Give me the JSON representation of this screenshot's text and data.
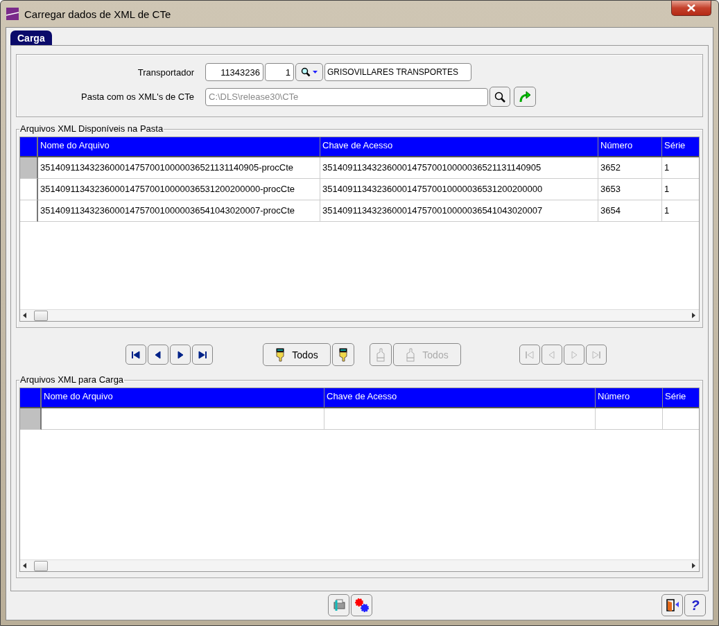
{
  "window": {
    "title": "Carregar dados de XML de CTe"
  },
  "tabs": [
    {
      "label": "Carga",
      "selected": true
    }
  ],
  "carrier": {
    "label": "Transportador",
    "code": "11343236",
    "branch": "1",
    "name": "GRISOVILLARES TRANSPORTES"
  },
  "folder": {
    "label": "Pasta com os XML's de CTe",
    "value": "C:\\DLS\\release30\\CTe",
    "disabled": true
  },
  "available": {
    "title": "Arquivos XML Disponíveis na Pasta",
    "columns": [
      "Nome do Arquivo",
      "Chave de Acesso",
      "Número",
      "Série"
    ],
    "rows": [
      {
        "selected": true,
        "cells": [
          "35140911343236000147570010000036521131140905-procCte",
          "35140911343236000147570010000036521131140905",
          "3652",
          "1"
        ]
      },
      {
        "selected": false,
        "cells": [
          "35140911343236000147570010000036531200200000-procCte",
          "35140911343236000147570010000036531200200000",
          "3653",
          "1"
        ]
      },
      {
        "selected": false,
        "cells": [
          "35140911343236000147570010000036541043020007-procCte",
          "35140911343236000147570010000036541043020007",
          "3654",
          "1"
        ]
      }
    ]
  },
  "nav_left": [
    {
      "kind": "first",
      "disabled": false
    },
    {
      "kind": "prev",
      "disabled": false
    },
    {
      "kind": "next",
      "disabled": false
    },
    {
      "kind": "last",
      "disabled": false
    }
  ],
  "move_buttons": [
    {
      "kind": "add-all",
      "label": "Todos",
      "disabled": false
    },
    {
      "kind": "add",
      "disabled": false
    },
    {
      "kind": "remove",
      "disabled": true
    },
    {
      "kind": "remove-all",
      "label": "Todos",
      "disabled": true
    }
  ],
  "nav_right": [
    {
      "kind": "first",
      "disabled": true
    },
    {
      "kind": "prev",
      "disabled": true
    },
    {
      "kind": "next",
      "disabled": true
    },
    {
      "kind": "last",
      "disabled": true
    }
  ],
  "load": {
    "title": "Arquivos XML para Carga",
    "columns": [
      "Nome do Arquivo",
      "Chave de Acesso",
      "Número",
      "Série"
    ],
    "rows": [
      {
        "selected": true
      }
    ]
  },
  "footer_buttons": [
    {
      "kind": "tools"
    },
    {
      "kind": "gears"
    },
    {
      "kind": "exit"
    },
    {
      "kind": "help",
      "label": "?"
    }
  ]
}
